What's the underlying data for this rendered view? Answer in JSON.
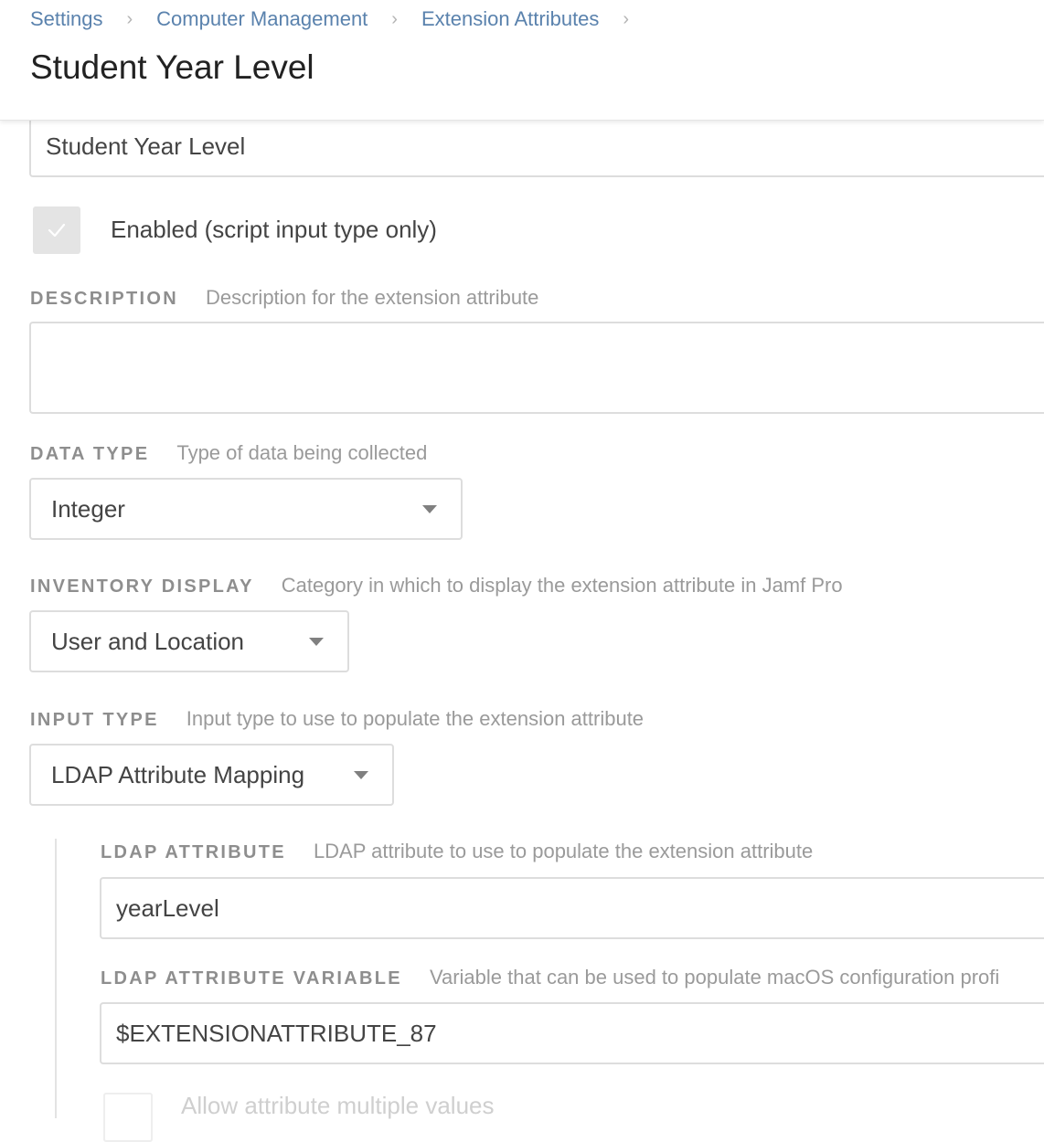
{
  "header": {
    "breadcrumbs": [
      "Settings",
      "Computer Management",
      "Extension Attributes"
    ],
    "separator": "›",
    "title": "Student Year Level"
  },
  "form": {
    "name_value": "Student Year Level",
    "enabled": {
      "label": "Enabled (script input type only)",
      "checked": true,
      "disabled": true
    },
    "description": {
      "label": "DESCRIPTION",
      "help": "Description for the extension attribute",
      "value": ""
    },
    "data_type": {
      "label": "DATA TYPE",
      "help": "Type of data being collected",
      "selected": "Integer"
    },
    "inventory_display": {
      "label": "INVENTORY DISPLAY",
      "help": "Category in which to display the extension attribute in Jamf Pro",
      "selected": "User and Location"
    },
    "input_type": {
      "label": "INPUT TYPE",
      "help": "Input type to use to populate the extension attribute",
      "selected": "LDAP Attribute Mapping"
    },
    "ldap_attribute": {
      "label": "LDAP ATTRIBUTE",
      "help": "LDAP attribute to use to populate the extension attribute",
      "value": "yearLevel"
    },
    "ldap_attribute_variable": {
      "label": "LDAP ATTRIBUTE VARIABLE",
      "help": "Variable that can be used to populate macOS configuration profi",
      "value": "$EXTENSIONATTRIBUTE_87"
    },
    "allow_multiple": {
      "label": "Allow attribute multiple values",
      "checked": false
    }
  },
  "colors": {
    "link": "#5a82ad",
    "border": "#dddddd",
    "label": "#8e8e8e",
    "disabled_checkbox": "#e4e4e4"
  }
}
